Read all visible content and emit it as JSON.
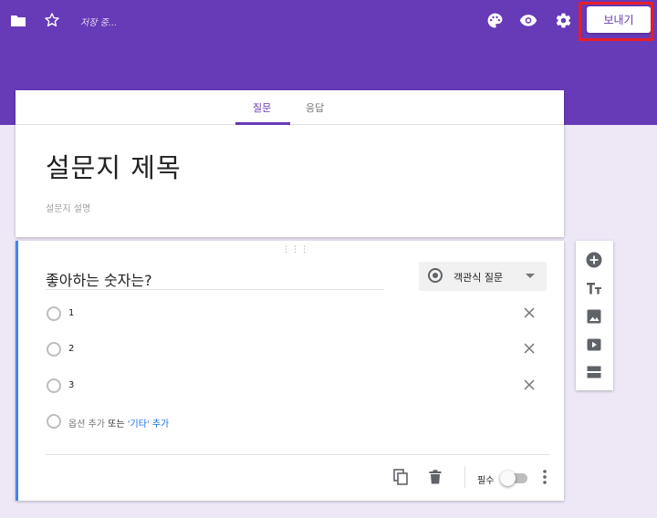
{
  "header": {
    "saving_text": "저장 중...",
    "send_label": "보내기",
    "bg_color": "#673ab7",
    "icons": [
      "folder-icon",
      "star-icon",
      "palette-icon",
      "eye-icon",
      "gear-icon"
    ]
  },
  "tabs": [
    {
      "label": "질문",
      "active": true
    },
    {
      "label": "응답",
      "active": false
    }
  ],
  "form": {
    "title": "설문지 제목",
    "description": "설문지 설명"
  },
  "question": {
    "text": "좋아하는 숫자는?",
    "type_label": "객관식 질문",
    "options": [
      "1",
      "2",
      "3"
    ],
    "add_option": "옵션 추가",
    "or_text": "또는",
    "add_other": "'기타' 추가",
    "required_label": "필수",
    "required_on": false
  },
  "side_toolbar": {
    "icons": [
      "add-question-icon",
      "title-text-icon",
      "image-icon",
      "video-icon",
      "section-icon"
    ]
  },
  "colors": {
    "accent": "#673ab7",
    "page_bg": "#ede7f6",
    "focus_bar": "#4285f4",
    "link": "#1a73e8",
    "highlight_box": "#e5202a"
  }
}
